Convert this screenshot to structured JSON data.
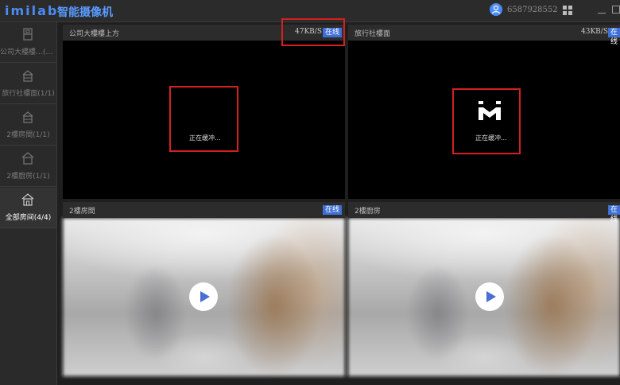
{
  "app": {
    "logo": "imilab",
    "title": "智能摄像机",
    "user_id": "6587928552"
  },
  "sidebar": {
    "items": [
      {
        "label": "公司大樓樓…(1/1)",
        "icon": "device-icon"
      },
      {
        "label": "旅行社樓面(1/1)",
        "icon": "building-icon"
      },
      {
        "label": "2樓房間(1/1)",
        "icon": "building-icon"
      },
      {
        "label": "2樓廚房(1/1)",
        "icon": "home-icon"
      },
      {
        "label": "全部房间(4/4)",
        "icon": "home-icon"
      }
    ]
  },
  "cameras": [
    {
      "title": "公司大樓樓上方",
      "speed": "47KB/S",
      "status": "在线",
      "state": "正在缓冲..."
    },
    {
      "title": "旅行社樓面",
      "speed": "43KB/S",
      "status": "在线",
      "state": "正在缓冲..."
    },
    {
      "title": "2樓房間",
      "speed": "",
      "status": "在线"
    },
    {
      "title": "2樓廚房",
      "speed": "",
      "status": "在线"
    }
  ],
  "colors": {
    "accent": "#3e6fd6",
    "highlight": "#d42020"
  }
}
